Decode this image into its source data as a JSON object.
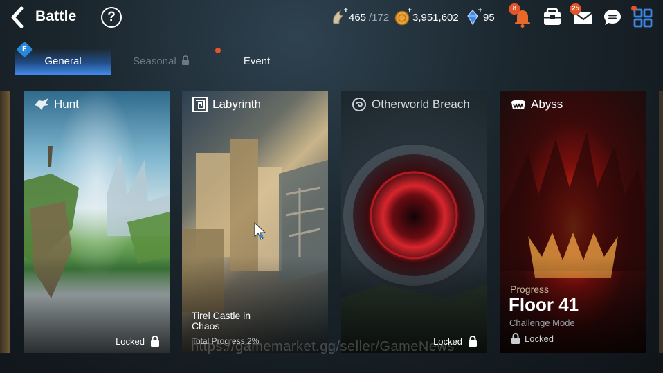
{
  "header": {
    "title": "Battle",
    "help_label": "?",
    "stamina": {
      "current": "465",
      "max": "/172"
    },
    "gold": "3,951,602",
    "crystals": "95",
    "notifications_badge": "8",
    "mail_badge": "25"
  },
  "tabs": [
    {
      "label": "General",
      "active": true
    },
    {
      "label": "Seasonal",
      "active": false,
      "locked": true
    },
    {
      "label": "Event",
      "active": false
    }
  ],
  "general_tab_badge": "E",
  "cards": {
    "hunt": {
      "title": "Hunt",
      "lock_label": "Locked"
    },
    "labyrinth": {
      "title": "Labyrinth",
      "subtitle": "Tirel Castle in Chaos",
      "progress": "Total Progress 2%"
    },
    "otherworld": {
      "title": "Otherworld Breach",
      "lock_label": "Locked"
    },
    "abyss": {
      "title": "Abyss",
      "progress_label": "Progress",
      "floor": "Floor 41",
      "mode": "Challenge Mode",
      "lock_label": "Locked"
    }
  },
  "watermark": "https://gamemarket.gg/seller/GameNews",
  "colors": {
    "accent_blue": "#2a86d8",
    "badge_orange": "#e2542a",
    "icon_blue": "#3d88e6",
    "gold_coin": "#e8a23a"
  }
}
